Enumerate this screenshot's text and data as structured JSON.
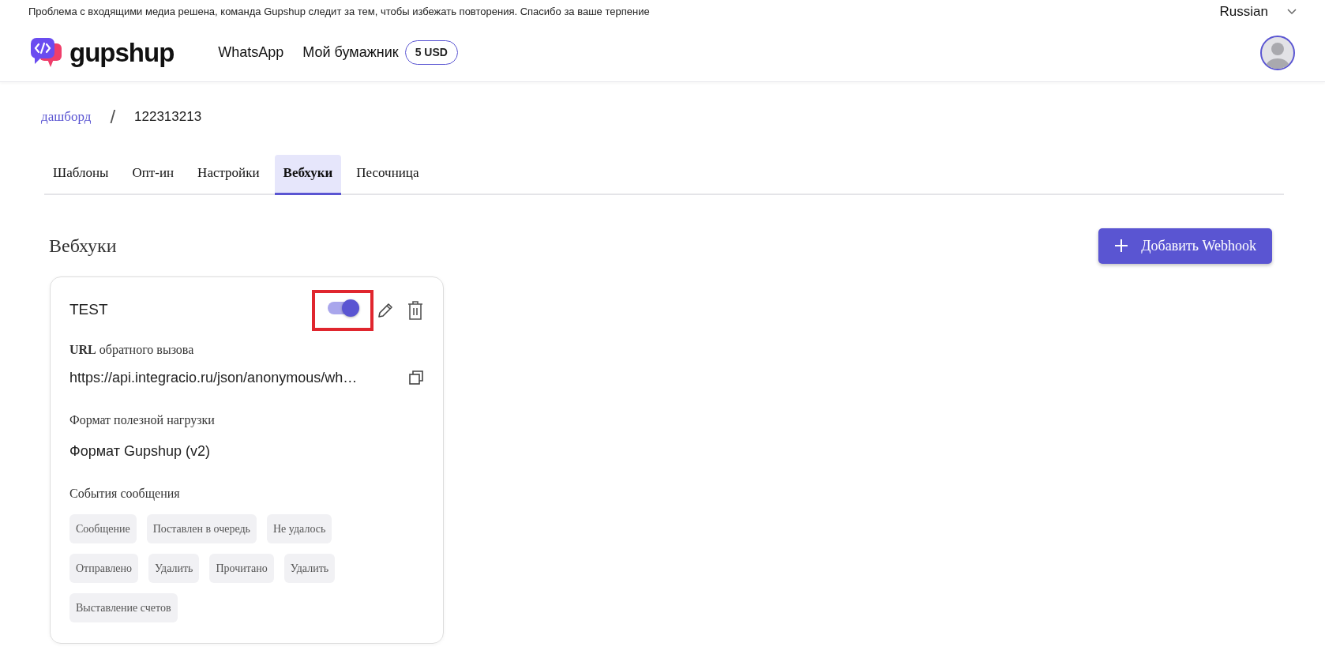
{
  "banner": {
    "text": "Проблема с входящими медиа решена, команда Gupshup следит за тем, чтобы избежать повторения. Спасибо за ваше терпение"
  },
  "language": {
    "value": "Russian"
  },
  "navbar": {
    "brand": "gupshup",
    "links": [
      "WhatsApp"
    ],
    "wallet": {
      "label": "Мой бумажник",
      "balance": "5 USD"
    }
  },
  "breadcrumb": [
    {
      "label": "дашборд",
      "kind": "link"
    },
    {
      "label": "/",
      "kind": "separator"
    },
    {
      "label": "122313213",
      "kind": "current"
    }
  ],
  "tabs": [
    {
      "label": "Шаблоны",
      "selected": false
    },
    {
      "label": "Опт-ин",
      "selected": false
    },
    {
      "label": "Настройки",
      "selected": false
    },
    {
      "label": "Вебхуки",
      "selected": true
    },
    {
      "label": "Песочница",
      "selected": false
    }
  ],
  "section": {
    "title": "Вебхуки",
    "add_button": "Добавить Webhook"
  },
  "webhooks": [
    {
      "name": "TEST",
      "enabled": true,
      "highlighted": true,
      "url_label": "**URL** обратного вызова",
      "url": "https://api.integracio.ru/json/anonymous/wh…",
      "format_label": "Формат полезной нагрузки",
      "format": "Формат Gupshup (v2)",
      "events_label": "События сообщения",
      "events": [
        "Сообщение",
        "Поставлен в очередь",
        "Не удалось",
        "Отправлено",
        "Удалить",
        "Прочитано",
        "Удалить",
        "Выставление счетов"
      ]
    }
  ]
}
